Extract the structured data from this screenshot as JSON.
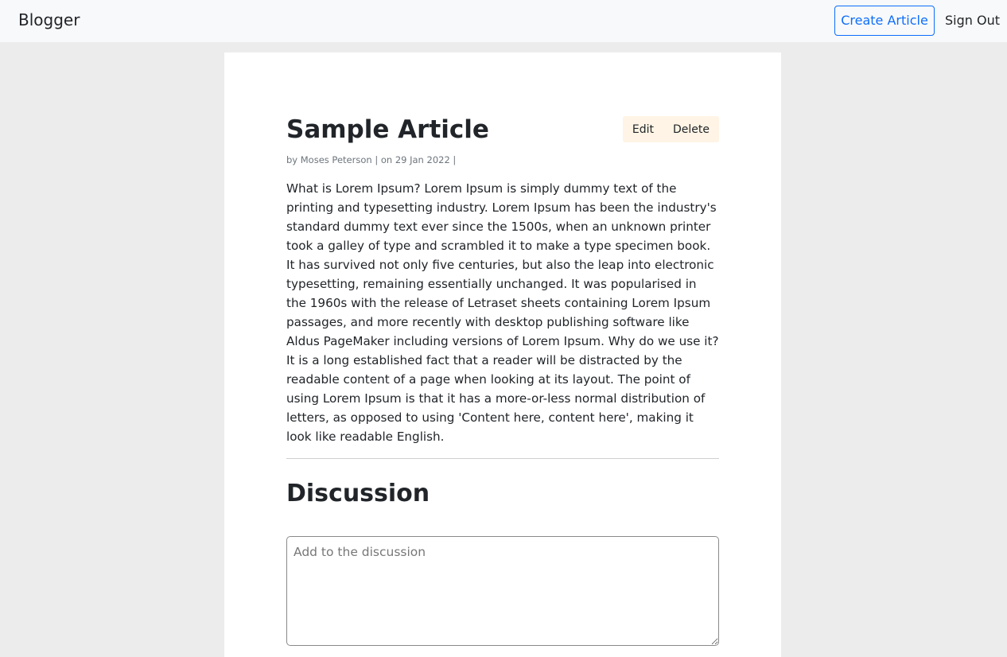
{
  "navbar": {
    "brand": "Blogger",
    "create_label": "Create Article",
    "signout_label": "Sign Out"
  },
  "article": {
    "title": "Sample Article",
    "edit_label": "Edit",
    "delete_label": "Delete",
    "meta": "by Moses Peterson | on 29 Jan 2022 |",
    "body": "What is Lorem Ipsum? Lorem Ipsum is simply dummy text of the printing and typesetting industry. Lorem Ipsum has been the industry's standard dummy text ever since the 1500s, when an unknown printer took a galley of type and scrambled it to make a type specimen book. It has survived not only five centuries, but also the leap into electronic typesetting, remaining essentially unchanged. It was popularised in the 1960s with the release of Letraset sheets containing Lorem Ipsum passages, and more recently with desktop publishing software like Aldus PageMaker including versions of Lorem Ipsum. Why do we use it? It is a long established fact that a reader will be distracted by the readable content of a page when looking at its layout. The point of using Lorem Ipsum is that it has a more-or-less normal distribution of letters, as opposed to using 'Content here, content here', making it look like readable English."
  },
  "discussion": {
    "heading": "Discussion",
    "placeholder": "Add to the discussion",
    "value": ""
  },
  "colors": {
    "accent": "#0d6efd",
    "navbar_bg": "#f8f9fa",
    "page_bg": "#ececec",
    "actions_bg": "#fff4e5"
  }
}
